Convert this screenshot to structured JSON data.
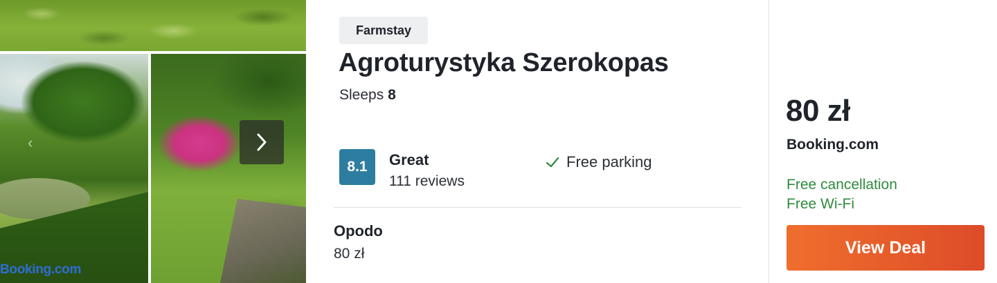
{
  "gallery": {
    "next_icon": "chevron-right-icon",
    "prev_icon": "chevron-left-icon",
    "watermark": "Booking.com"
  },
  "listing": {
    "type_badge": "Farmstay",
    "title": "Agroturystyka Szerokopas",
    "sleeps_label": "Sleeps",
    "sleeps_count": "8"
  },
  "rating": {
    "score": "8.1",
    "label": "Great",
    "reviews": "111 reviews",
    "badge_color": "#2d7da0"
  },
  "amenities": [
    {
      "icon": "check-icon",
      "label": "Free parking"
    }
  ],
  "alternate_offer": {
    "partner": "Opodo",
    "price": "80 zł"
  },
  "deal": {
    "price": "80 zł",
    "provider": "Booking.com",
    "perks": [
      "Free cancellation",
      "Free Wi-Fi"
    ],
    "perk_color": "#2f8a3e",
    "button_label": "View Deal",
    "button_color": "#e55a2a"
  }
}
